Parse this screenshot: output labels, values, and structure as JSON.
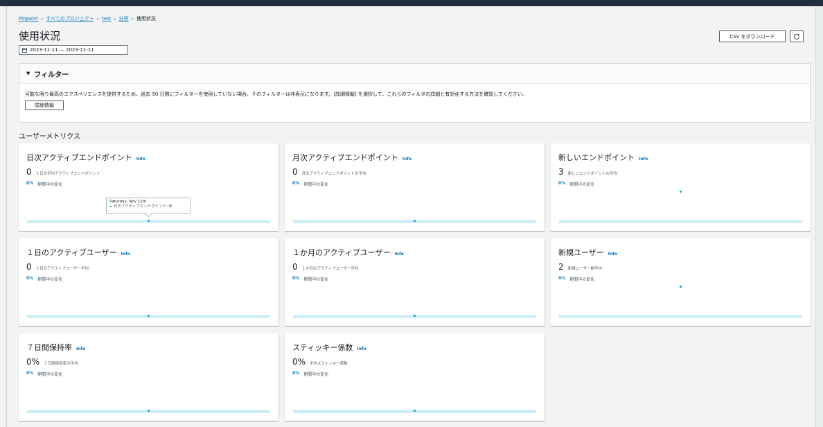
{
  "breadcrumb": {
    "items": [
      "Pinpoint",
      "すべてのプロジェクト",
      "test",
      "分析"
    ],
    "current": "使用状況"
  },
  "page": {
    "title": "使用状況",
    "date_range": "2023-11-11 — 2023-11-11",
    "download_label": "CSV をダウンロード",
    "refresh_icon": "refresh-icon"
  },
  "filter": {
    "heading": "フィルター",
    "description": "可能な限り最高のエクスペリエンスを提供するため、過去 90 日間にフィルターを使用していない場合、そのフィルターは非表示になります。[詳細情報] を選択して、これらのフィルタの詳細と有効化する方法を確認してください。",
    "details_button": "詳細情報"
  },
  "section_title": "ユーザーメトリクス",
  "cards": [
    {
      "title": "日次アクティブエンドポイント",
      "info": "Info",
      "value": "0",
      "sub": "１日の平均アクティブエンドポイント",
      "change_pct": "0%",
      "change_label": "期間中の変化",
      "point_y": 0
    },
    {
      "title": "月次アクティブエンドポイント",
      "info": "Info",
      "value": "0",
      "sub": "月次アクティブエンドポイントの平均",
      "change_pct": "0%",
      "change_label": "期間中の変化",
      "point_y": 0
    },
    {
      "title": "新しいエンドポイント",
      "info": "Info",
      "value": "3",
      "sub": "新しいエンドポイントの平均",
      "change_pct": "0%",
      "change_label": "期間中の変化",
      "point_y": 3
    },
    {
      "title": "１日のアクティブユーザー",
      "info": "Info",
      "value": "0",
      "sub": "１日のアクティブユーザー平均",
      "change_pct": "0%",
      "change_label": "期間中の変化",
      "point_y": 0
    },
    {
      "title": "１か月のアクティブユーザー",
      "info": "Info",
      "value": "0",
      "sub": "１か月のアクティブユーザー平均",
      "change_pct": "0%",
      "change_label": "期間中の変化",
      "point_y": 0
    },
    {
      "title": "新規ユーザー",
      "info": "Info",
      "value": "2",
      "sub": "新規ユーザー数平均",
      "change_pct": "0%",
      "change_label": "期間中の変化",
      "point_y": 2
    },
    {
      "title": "７日間保持率",
      "info": "Info",
      "value": "0%",
      "sub": "７日間保持率の平均",
      "change_pct": "0%",
      "change_label": "期間中の変化",
      "point_y": 0
    },
    {
      "title": "スティッキー係数",
      "info": "Info",
      "value": "0%",
      "sub": "平均スティッキー係数",
      "change_pct": "0%",
      "change_label": "期間中の変化",
      "point_y": 0
    }
  ],
  "tooltip": {
    "date": "Saturday, Nov 11th",
    "series": "日次アクティブエンドポイント",
    "value": "0"
  }
}
